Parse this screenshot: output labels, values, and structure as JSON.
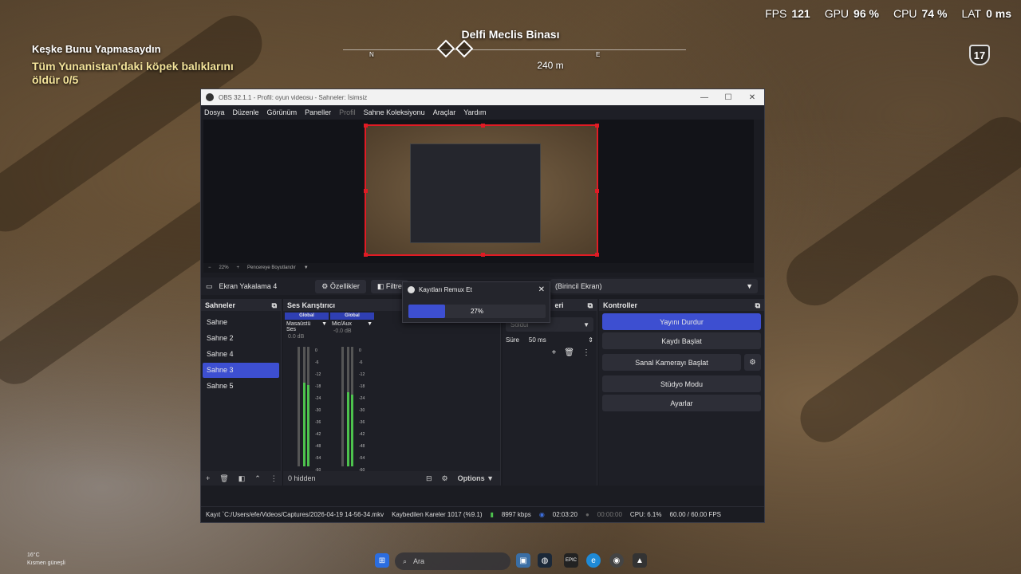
{
  "hud": {
    "fps_label": "FPS",
    "fps_value": "121",
    "gpu_label": "GPU",
    "gpu_value": "96 %",
    "cpu_label": "CPU",
    "cpu_value": "74 %",
    "lat_label": "LAT",
    "lat_value": "0 ms",
    "quest_title": "Keşke Bunu Yapmasaydın",
    "quest_objective": "Tüm Yunanistan'daki köpek balıklarını öldür 0/5",
    "location": "Delfi Meclis Binası",
    "distance": "240 m",
    "compass": [
      "N",
      "E"
    ],
    "level": "17"
  },
  "obs": {
    "title": "OBS 32.1.1 - Profil: oyun videosu - Sahneler: İsimsiz",
    "menu": [
      "Dosya",
      "Düzenle",
      "Görünüm",
      "Paneller",
      "Profil",
      "Sahne Koleksiyonu",
      "Araçlar",
      "Yardım"
    ],
    "zoom": "22%",
    "zoom_mode": "Pencereye Boyutlandır",
    "source_name": "Ekran Yakalama 4",
    "properties_label": "Özellikler",
    "filters_label": "Filtre",
    "display_select": "(Birincil Ekran)",
    "scenes_title": "Sahneler",
    "scenes": [
      "Sahne",
      "Sahne 2",
      "Sahne 4",
      "Sahne 3",
      "Sahne 5"
    ],
    "active_scene": "Sahne 3",
    "mixer_title": "Ses Karıştırıcı",
    "mixer": [
      {
        "global": "Global",
        "name": "Masaüstü Ses",
        "db": "0.0 dB"
      },
      {
        "global": "Global",
        "name": "Mic/Aux",
        "db": "-0.0 dB"
      }
    ],
    "meter_ticks": [
      "0",
      "-6",
      "-12",
      "-18",
      "-24",
      "-30",
      "-36",
      "-42",
      "-48",
      "-54",
      "-60"
    ],
    "mixer_hidden": "0 hidden",
    "options_label": "Options",
    "transitions_title": "eri",
    "transition_select": "Solduı",
    "duration_label": "Süre",
    "duration_value": "50 ms",
    "controls_title": "Kontroller",
    "controls": {
      "stop_stream": "Yayını Durdur",
      "start_record": "Kaydı Başlat",
      "start_virtualcam": "Sanal Kamerayı Başlat",
      "studio_mode": "Stüdyo Modu",
      "settings": "Ayarlar"
    },
    "status": {
      "record_path": "Kayıt `C:/Users/efe/Videos/Captures/2026-04-19 14-56-34.mkv",
      "dropped": "Kaybedilen Kareler 1017 (%9.1)",
      "bitrate": "8997 kbps",
      "stream_time": "02:03:20",
      "record_time": "00:00:00",
      "cpu": "CPU: 6.1%",
      "fps": "60.00 / 60.00 FPS"
    }
  },
  "remux": {
    "title": "Kayıtları Remux Et",
    "progress_text": "27%",
    "progress_value": 0.27
  },
  "taskbar": {
    "temp": "16°C",
    "weather": "Kısmen güneşli",
    "search_placeholder": "Ara"
  },
  "colors": {
    "accent": "#3d4fd1",
    "record_border": "#e01b24",
    "meter_green": "#4dc24d"
  }
}
